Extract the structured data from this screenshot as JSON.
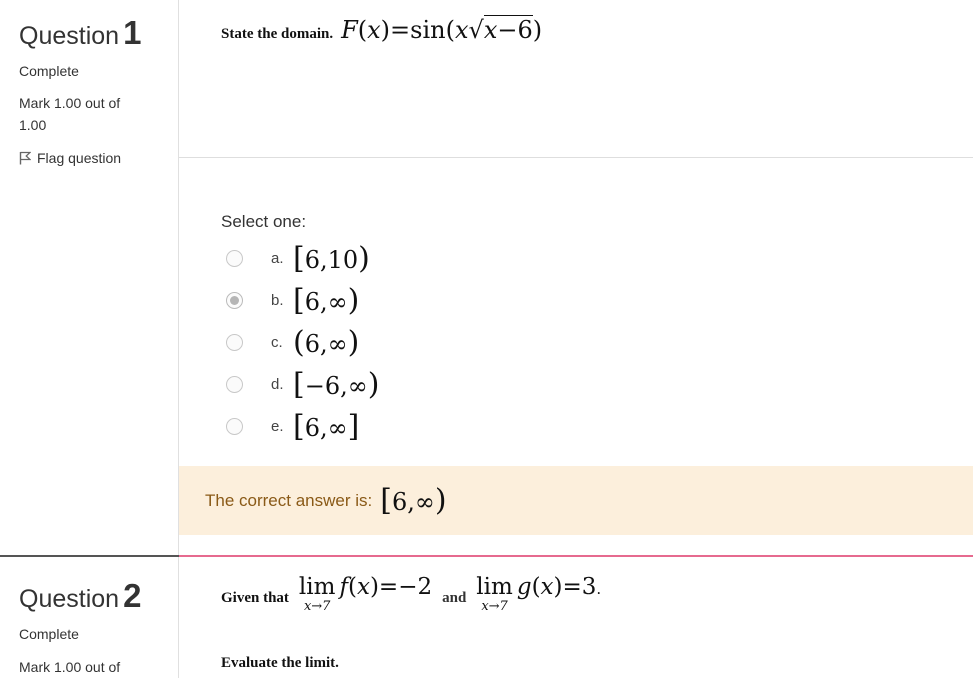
{
  "question1": {
    "label": "Question",
    "number": "1",
    "state": "Complete",
    "grade": "Mark 1.00 out of 1.00",
    "flag_label": "Flag question",
    "stem_label": "State the domain.",
    "formula": {
      "lhs_fn": "F",
      "lhs_var": "x",
      "equals": "=",
      "rhs_fn": "sin",
      "rhs_var": "x",
      "radicand": "x",
      "minus": "−",
      "constant": "6"
    },
    "select_one": "Select one:",
    "options": [
      {
        "letter": "a.",
        "open": "[",
        "value": "6,10",
        "close": ")",
        "checked": false
      },
      {
        "letter": "b.",
        "open": "[",
        "value": "6,∞",
        "close": ")",
        "checked": true
      },
      {
        "letter": "c.",
        "open": "(",
        "value": "6,∞",
        "close": ")",
        "checked": false
      },
      {
        "letter": "d.",
        "open": "[",
        "value": "−6,∞",
        "close": ")",
        "checked": false
      },
      {
        "letter": "e.",
        "open": "[",
        "value": "6,∞",
        "close": "]",
        "checked": false
      }
    ],
    "feedback": {
      "label": "The correct answer is:",
      "open": "[",
      "value": "6,∞",
      "close": ")"
    }
  },
  "question2": {
    "label": "Question",
    "number": "2",
    "state": "Complete",
    "grade": "Mark 1.00 out of",
    "given": "Given that",
    "limit1": {
      "word": "lim",
      "sub": "x→7",
      "fn": "f",
      "var": "x",
      "rhs": "=−2"
    },
    "and": "and",
    "limit2": {
      "word": "lim",
      "sub": "x→7",
      "fn": "g",
      "var": "x",
      "rhs": "=3"
    },
    "period": ".",
    "evaluate": "Evaluate the limit."
  },
  "colors": {
    "feedback_bg": "#fcefdc",
    "feedback_text": "#8a5a17",
    "question_divider": "#e66a8f"
  }
}
